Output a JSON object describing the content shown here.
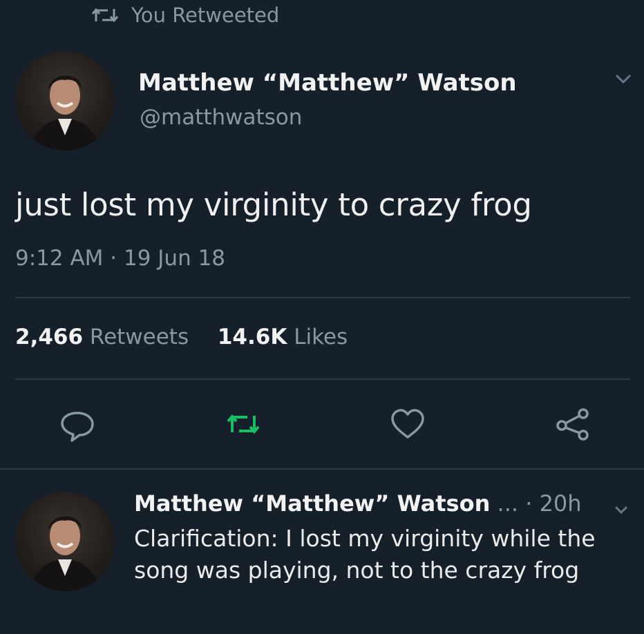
{
  "retweet_header": {
    "text": "You Retweeted",
    "icon": "retweet-icon"
  },
  "tweet": {
    "author_name": "Matthew “Matthew” Watson",
    "handle": "@matthwatson",
    "text": "just lost my virginity to crazy frog",
    "timestamp": "9:12 AM · 19 Jun 18",
    "stats": {
      "retweets_count": "2,466",
      "retweets_label": "Retweets",
      "likes_count": "14.6K",
      "likes_label": "Likes"
    },
    "actions": [
      "reply-icon",
      "retweet-icon",
      "like-icon",
      "share-icon"
    ]
  },
  "reply": {
    "author_name": "Matthew “Matthew” Watson",
    "ellipsis": " ...",
    "time": " · 20h",
    "text": "Clarification: I lost my virginity while the song was playing, not to the crazy frog"
  },
  "colors": {
    "background": "#15202b",
    "secondary_text": "#8899a6",
    "retweet_active": "#17bf63"
  }
}
